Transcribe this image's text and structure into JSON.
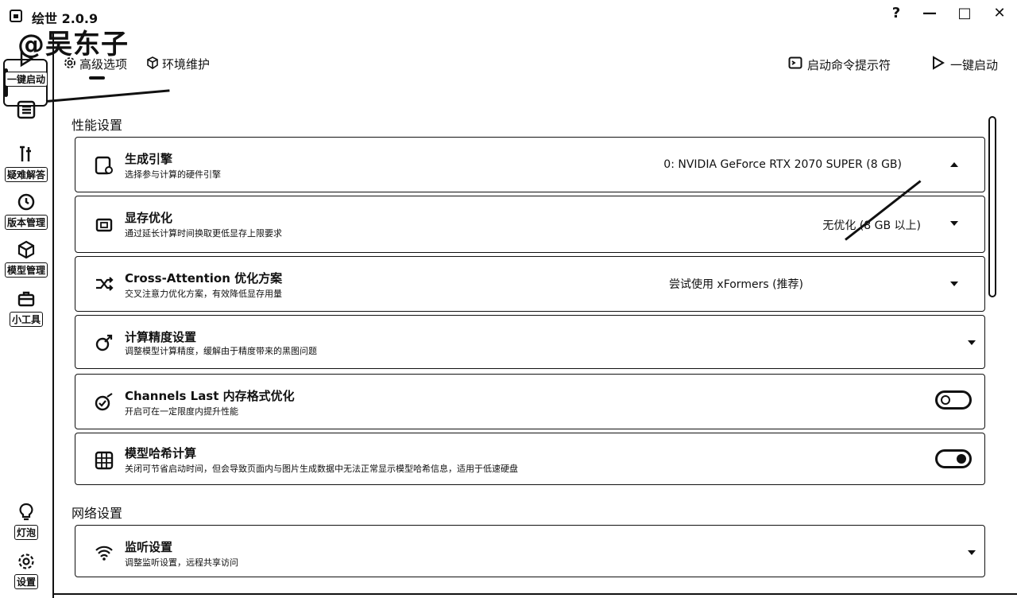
{
  "app": {
    "title": "绘世 2.0.9",
    "watermark": "@吴东子"
  },
  "window_controls": {
    "help": "?",
    "minimize": "—",
    "maximize": "□",
    "close": "✕"
  },
  "nav": {
    "items": [
      {
        "label": "一键启动",
        "icon": "play-icon"
      },
      {
        "label": "",
        "icon": "list-icon"
      },
      {
        "label": "疑难解答",
        "icon": "tools-icon"
      },
      {
        "label": "版本管理",
        "icon": "history-icon"
      },
      {
        "label": "模型管理",
        "icon": "cube-icon"
      },
      {
        "label": "小工具",
        "icon": "toolbox-icon"
      }
    ],
    "bottom": [
      {
        "label": "灯泡",
        "icon": "lightbulb-icon"
      },
      {
        "label": "设置",
        "icon": "gear-icon"
      }
    ]
  },
  "tabs": [
    {
      "label": "高级选项",
      "icon": "gear-small-icon"
    },
    {
      "label": "环境维护",
      "icon": "package-icon"
    }
  ],
  "actions": {
    "console": "启动命令提示符",
    "launch": "一键启动"
  },
  "sections": {
    "performance": {
      "title": "性能设置",
      "cards": [
        {
          "title": "生成引擎",
          "desc": "选择参与计算的硬件引擎",
          "value": "0: NVIDIA GeForce RTX 2070 SUPER (8 GB)",
          "control": "chevron-up"
        },
        {
          "title": "显存优化",
          "desc": "通过延长计算时间换取更低显存上限要求",
          "value": "无优化 (8 GB 以上)",
          "control": "chevron-down"
        },
        {
          "title": "Cross-Attention 优化方案",
          "desc": "交叉注意力优化方案，有效降低显存用量",
          "value": "尝试使用 xFormers (推荐)",
          "control": "chevron-down"
        },
        {
          "title": "计算精度设置",
          "desc": "调整模型计算精度，缓解由于精度带来的黑图问题",
          "value": "",
          "control": "chevron-down"
        },
        {
          "title": "Channels Last 内存格式优化",
          "desc": "开启可在一定限度内提升性能",
          "value": "",
          "control": "toggle-off"
        },
        {
          "title": "模型哈希计算",
          "desc": "关闭可节省启动时间，但会导致页面内与图片生成数据中无法正常显示模型哈希信息，适用于低速硬盘",
          "value": "",
          "control": "toggle-on"
        }
      ]
    },
    "network": {
      "title": "网络设置",
      "cards": [
        {
          "title": "监听设置",
          "desc": "调整监听设置，远程共享访问",
          "value": "",
          "control": "chevron-down"
        }
      ]
    }
  },
  "toggles": {
    "channels_last": false,
    "model_hash": true
  }
}
